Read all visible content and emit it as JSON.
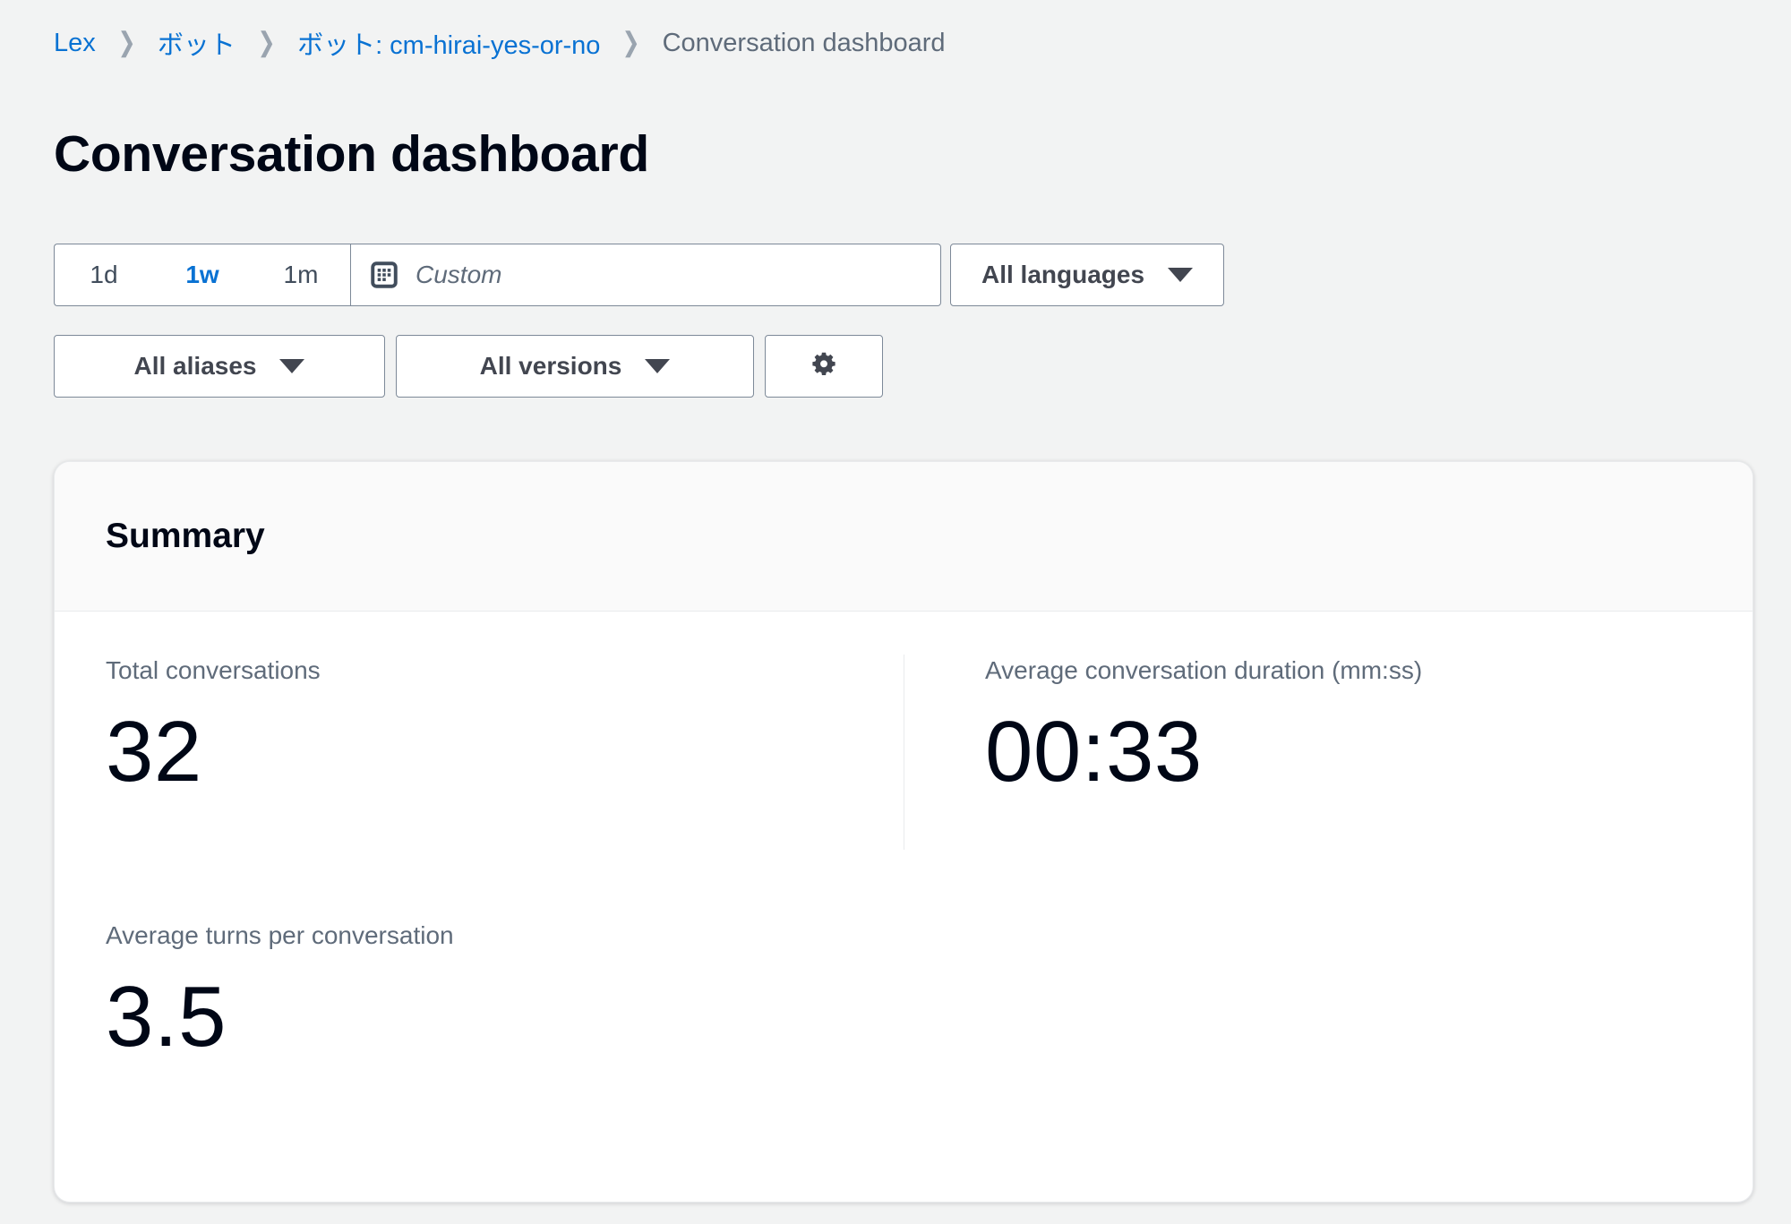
{
  "breadcrumb": {
    "separator": "❯",
    "items": [
      {
        "label": "Lex",
        "type": "link"
      },
      {
        "label": "ボット",
        "type": "link"
      },
      {
        "label": "ボット: cm-hirai-yes-or-no",
        "type": "link"
      },
      {
        "label": "Conversation dashboard",
        "type": "current"
      }
    ]
  },
  "page": {
    "title": "Conversation dashboard"
  },
  "filters": {
    "date_range": {
      "segments": [
        {
          "label": "1d",
          "selected": false
        },
        {
          "label": "1w",
          "selected": true
        },
        {
          "label": "1m",
          "selected": false
        }
      ],
      "custom": {
        "icon": "calendar-icon",
        "placeholder": "Custom",
        "value": ""
      }
    },
    "language": {
      "label": "All languages",
      "icon": "chevron-down-icon"
    },
    "alias": {
      "label": "All aliases",
      "icon": "chevron-down-icon"
    },
    "version": {
      "label": "All versions",
      "icon": "chevron-down-icon"
    },
    "settings": {
      "icon": "gear-icon"
    }
  },
  "summary": {
    "title": "Summary",
    "metrics": [
      {
        "label": "Total conversations",
        "value": "32"
      },
      {
        "label": "Average conversation duration (mm:ss)",
        "value": "00:33"
      },
      {
        "label": "Average turns per conversation",
        "value": "3.5"
      }
    ]
  },
  "colors": {
    "accent_link": "#0972d3",
    "text_primary": "#000716",
    "text_secondary": "#5f6b7a",
    "page_background": "#f2f3f3",
    "card_background": "#ffffff",
    "border": "#7d8998"
  }
}
